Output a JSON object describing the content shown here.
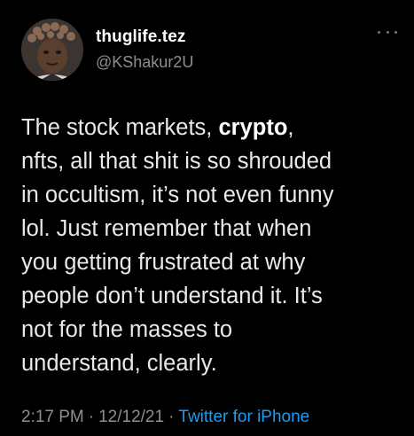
{
  "author": {
    "display_name": "thuglife.tez",
    "handle": "@KShakur2U"
  },
  "tweet": {
    "lines": [
      {
        "before": "The stock markets, ",
        "bold": "crypto",
        "after": ","
      },
      {
        "text": "nfts, all that shit is so shrouded"
      },
      {
        "text": "in occultism, it’s not even funny"
      },
      {
        "text": "lol. Just remember that when"
      },
      {
        "text": "you getting frustrated at why"
      },
      {
        "text": "people don’t understand it. It’s"
      },
      {
        "text": "not for the masses to"
      },
      {
        "text": "understand, clearly."
      }
    ]
  },
  "meta": {
    "time": "2:17 PM",
    "date": "12/12/21",
    "separator": "·",
    "source": "Twitter for iPhone"
  },
  "icons": {
    "more": "more-horizontal-icon"
  },
  "colors": {
    "background": "#000000",
    "text": "#e7e9ea",
    "secondary": "#8b8f94",
    "link": "#1d9bf0"
  }
}
